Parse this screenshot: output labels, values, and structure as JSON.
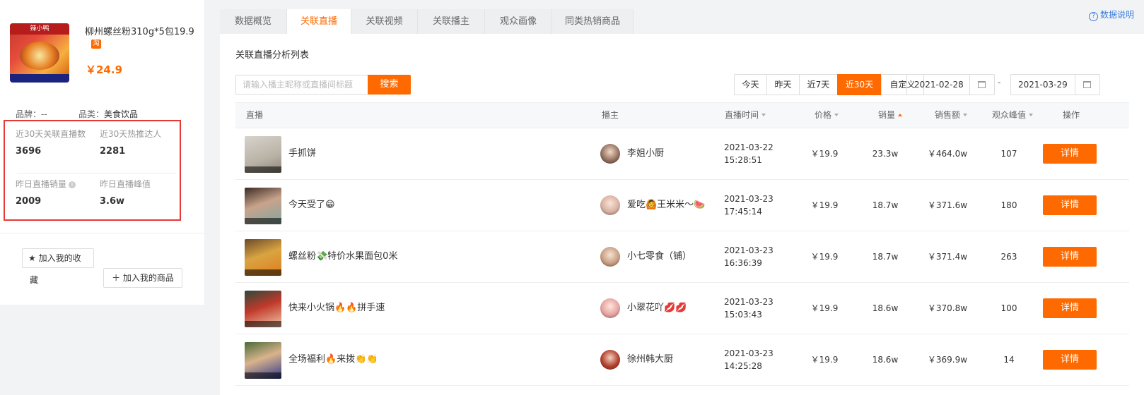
{
  "product": {
    "image_text": "辣小鸭",
    "title": "柳州螺丝粉310g*5包19.9",
    "tmall_badge": "淘",
    "price": "￥24.9",
    "brand_label": "品牌：",
    "brand_value": "--",
    "category_label": "品类：",
    "category_value": "美食饮品"
  },
  "stats": {
    "live_count_label": "近30天关联直播数",
    "live_count_value": "3696",
    "hot_anchors_label": "近30天热推达人",
    "hot_anchors_value": "2281",
    "yesterday_sales_label": "昨日直播销量",
    "yesterday_sales_value": "2009",
    "yesterday_peak_label": "昨日直播峰值",
    "yesterday_peak_value": "3.6w"
  },
  "actions": {
    "favorite_label": "加入我的收",
    "favorite_wrap": "藏",
    "add_product_label": "加入我的商品"
  },
  "tabs": [
    "数据概览",
    "关联直播",
    "关联视频",
    "关联播主",
    "观众画像",
    "同类热销商品"
  ],
  "data_note": "数据说明",
  "list": {
    "title": "关联直播分析列表",
    "search_placeholder": "请输入播主昵称或直播间标题",
    "search_button": "搜索",
    "ranges": [
      "今天",
      "昨天",
      "近7天",
      "近30天",
      "自定义"
    ],
    "date_start": "2021-02-28",
    "date_end": "2021-03-29",
    "date_dash": "-"
  },
  "columns": {
    "live": "直播",
    "anchor": "播主",
    "time": "直播时间",
    "price": "价格",
    "sales": "销量",
    "revenue": "销售额",
    "peak": "观众峰值",
    "action": "操作"
  },
  "rows": [
    {
      "title": "手抓饼",
      "anchor": "李姐小厨",
      "date": "2021-03-22",
      "time": "15:28:51",
      "price": "￥19.9",
      "sales": "23.3w",
      "revenue": "￥464.0w",
      "peak": "107",
      "action": "详情"
    },
    {
      "title": "今天受了😁",
      "anchor": "爱吃🙆王米米～🍉",
      "date": "2021-03-23",
      "time": "17:45:14",
      "price": "￥19.9",
      "sales": "18.7w",
      "revenue": "￥371.6w",
      "peak": "180",
      "action": "详情"
    },
    {
      "title": "螺丝粉💸特价水果面包0米",
      "anchor": "小七零食（铺）",
      "date": "2021-03-23",
      "time": "16:36:39",
      "price": "￥19.9",
      "sales": "18.7w",
      "revenue": "￥371.4w",
      "peak": "263",
      "action": "详情"
    },
    {
      "title": "快来小火锅🔥🔥拼手速",
      "anchor": "小翠花吖💋💋",
      "date": "2021-03-23",
      "time": "15:03:43",
      "price": "￥19.9",
      "sales": "18.6w",
      "revenue": "￥370.8w",
      "peak": "100",
      "action": "详情"
    },
    {
      "title": "全场福利🔥来拨👏👏",
      "anchor": "徐州韩大厨",
      "date": "2021-03-23",
      "time": "14:25:28",
      "price": "￥19.9",
      "sales": "18.6w",
      "revenue": "￥369.9w",
      "peak": "14",
      "action": "详情"
    }
  ],
  "colors": {
    "accent": "#ff6a00",
    "link": "#3b7ddd",
    "highlight_border": "#e53935"
  }
}
